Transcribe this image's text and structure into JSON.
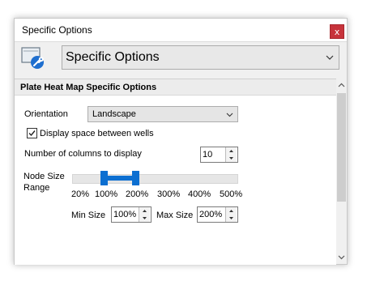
{
  "window": {
    "title": "Specific Options",
    "close_label": "x"
  },
  "selector": {
    "value": "Specific Options"
  },
  "panel": {
    "header": "Plate Heat Map Specific Options",
    "orientation": {
      "label": "Orientation",
      "value": "Landscape"
    },
    "display_space": {
      "label": "Display space between wells",
      "checked": true
    },
    "columns": {
      "label": "Number of columns to display",
      "value": "10"
    },
    "node_size": {
      "label_line1": "Node Size",
      "label_line2": "Range",
      "ticks": [
        "20%",
        "100%",
        "200%",
        "300%",
        "400%",
        "500%"
      ],
      "range_min_percent": 100,
      "range_max_percent": 200,
      "min_label": "Min Size",
      "min_value": "100%",
      "max_label": "Max Size",
      "max_value": "200%"
    }
  },
  "colors": {
    "accent": "#0c6fd1",
    "close": "#c7333b"
  }
}
